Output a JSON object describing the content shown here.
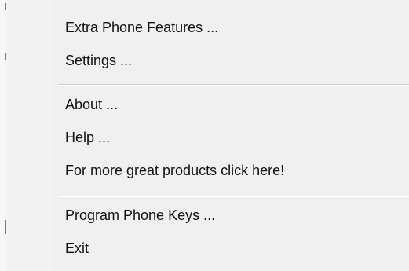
{
  "menu": {
    "items": [
      {
        "label": "Extra Phone Features ..."
      },
      {
        "label": "Settings ..."
      },
      {
        "label": "About ..."
      },
      {
        "label": "Help ..."
      },
      {
        "label": "For more great products click here!"
      },
      {
        "label": "Program Phone Keys ..."
      },
      {
        "label": "Exit"
      }
    ]
  },
  "colors": {
    "menu_background": "#f0f0f0",
    "separator": "#cfcfcf",
    "text": "#111111"
  }
}
